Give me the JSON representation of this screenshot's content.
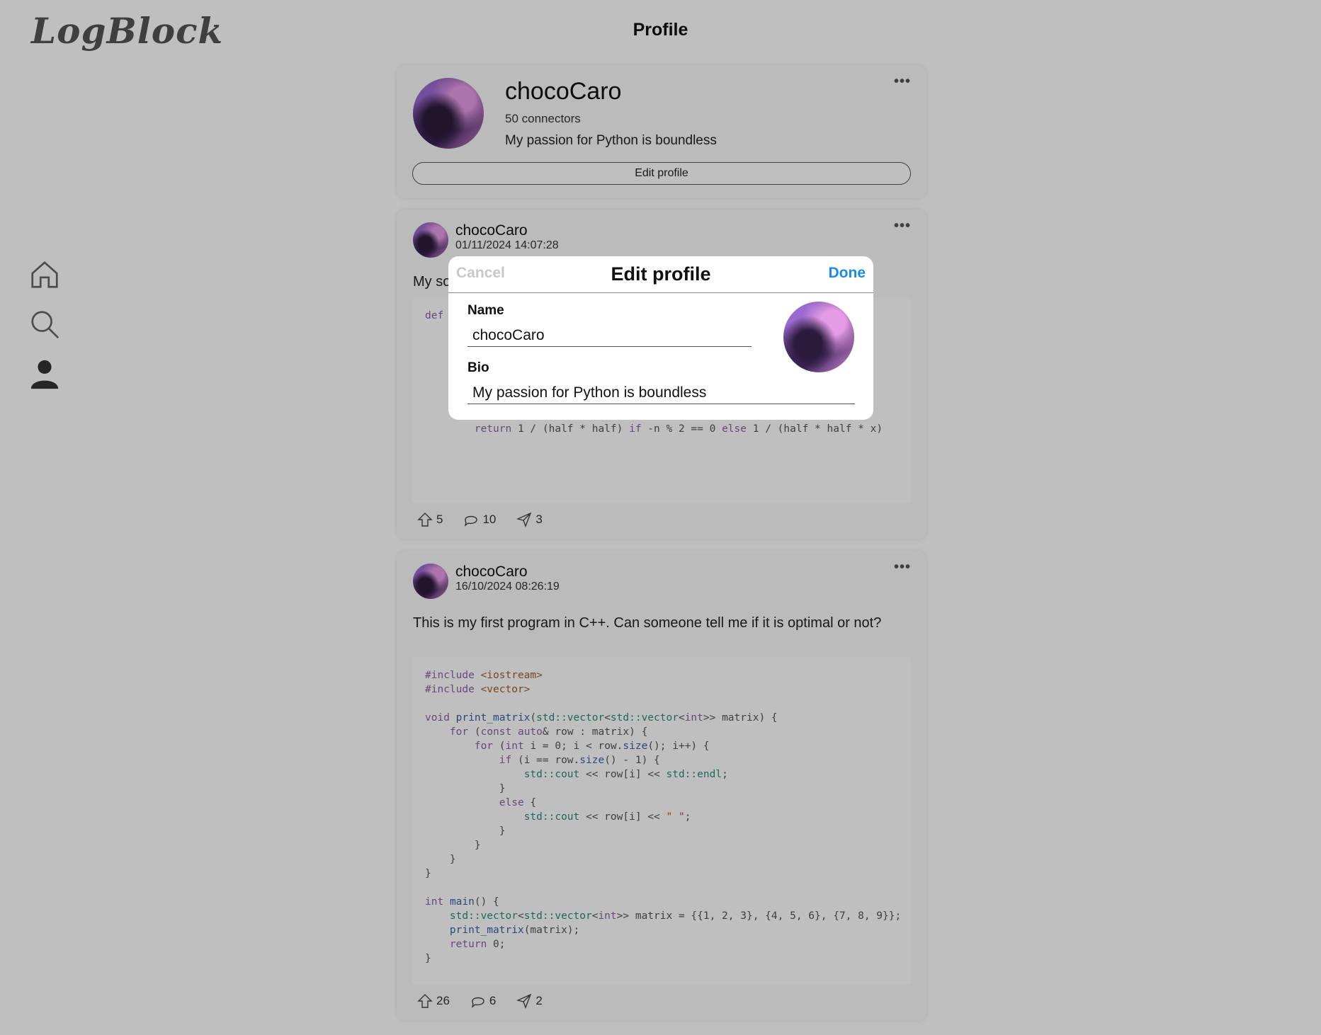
{
  "app": {
    "logo": "LogBlock",
    "page_title": "Profile"
  },
  "sidebar": {
    "items": [
      {
        "name": "home",
        "icon": "home-icon"
      },
      {
        "name": "search",
        "icon": "search-icon"
      },
      {
        "name": "profile",
        "icon": "user-icon"
      }
    ]
  },
  "profile": {
    "username": "chocoCaro",
    "connectors": "50 connectors",
    "bio": "My passion for Python is boundless",
    "edit_label": "Edit profile",
    "more": "•••"
  },
  "posts": [
    {
      "user": "chocoCaro",
      "time": "01/11/2024 14:07:28",
      "text": "My so",
      "more": "•••",
      "upvotes": "5",
      "comments": "10",
      "shares": "3"
    },
    {
      "user": "chocoCaro",
      "time": "16/10/2024 08:26:19",
      "text": "This is my first program in C++. Can someone tell me if it is optimal or not?",
      "more": "•••",
      "upvotes": "26",
      "comments": "6",
      "shares": "2"
    }
  ],
  "modal": {
    "cancel_label": "Cancel",
    "title": "Edit profile",
    "done_label": "Done",
    "name_label": "Name",
    "name_value": "chocoCaro",
    "bio_label": "Bio",
    "bio_value": "My passion for Python is boundless"
  },
  "colors": {
    "accent": "#1e88e5",
    "overlay": "rgba(0,0,0,0.25)"
  }
}
